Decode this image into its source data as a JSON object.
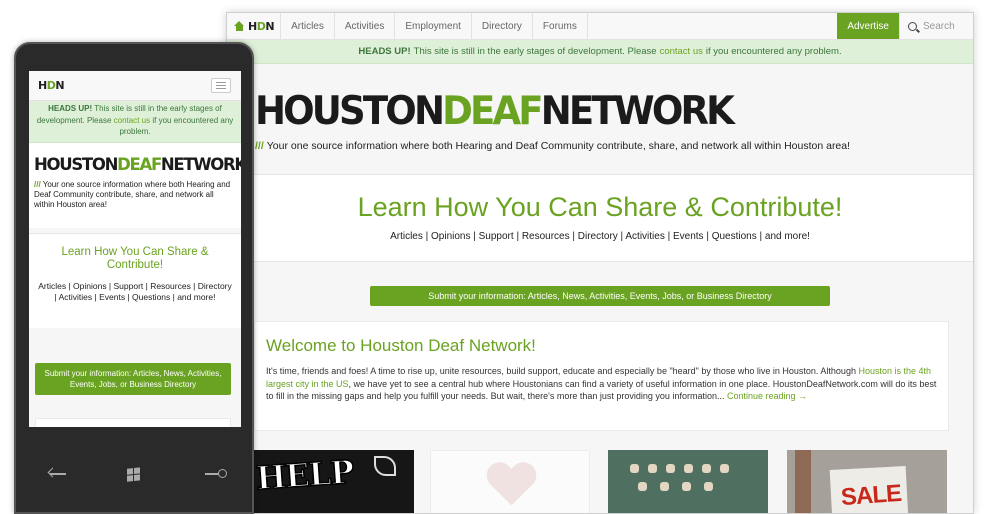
{
  "desktop": {
    "nav": {
      "logo": {
        "prefix": "H",
        "mid": "D",
        "suffix": "N"
      },
      "items": [
        "Articles",
        "Activities",
        "Employment",
        "Directory",
        "Forums"
      ],
      "advertise": "Advertise",
      "search_placeholder": "Search"
    },
    "alert": {
      "strong": "HEADS UP!",
      "text_before": "This site is still in the early stages of development. Please",
      "link": "contact us",
      "text_after": "if you encountered any problem."
    },
    "hero": {
      "logo_houston": "HOUSTON",
      "logo_deaf": "DEAF",
      "logo_network": "NETWORK",
      "tag_slashes": "///",
      "tagline": "Your one source information where both Hearing and Deaf Community contribute, share, and network all within Houston area!"
    },
    "learn": {
      "heading": "Learn How You Can Share & Contribute!",
      "links": "Articles | Opinions | Support | Resources | Directory | Activities | Events | Questions | and more!"
    },
    "submit_button": "Submit your information: Articles, News, Activities, Events, Jobs, or Business Directory",
    "welcome": {
      "title": "Welcome to Houston Deaf Network!",
      "p1": "It's time, friends and foes! A time to rise up, unite resources, build support, educate and especially be \"heard\" by those who live in Houston. Although",
      "link1": "Houston is the 4th largest city in the US",
      "p2": ", we have yet to see a central hub where Houstonians can find a variety of useful information in one place. HoustonDeafNetwork.com will do its best to fill in the missing gaps and help you fulfill your needs. But wait, there's more than just providing you information...",
      "continue": "Continue reading →"
    },
    "thumbs": {
      "t1_text": "HELP"
    },
    "t4_text": "SALE"
  },
  "phone": {
    "alert": {
      "strong": "HEADS UP!",
      "text_before": "This site is still in the early stages of development. Please",
      "link": "contact us",
      "text_after": "if you encountered any problem."
    },
    "tagline": "Your one source information where both Hearing and Deaf Community contribute, share, and network all within Houston area!",
    "learn_heading": "Learn How You Can Share & Contribute!",
    "learn_links": "Articles | Opinions | Support | Resources | Directory | Activities | Events | Questions | and more!",
    "submit_button": "Submit your information: Articles, News, Activities, Events, Jobs, or Business Directory"
  },
  "colors": {
    "accent": "#6aa221",
    "alert_bg": "#dff0d8",
    "alert_text": "#3c763d"
  },
  "icons": [
    "home-icon",
    "search-icon",
    "menu-icon",
    "back-icon",
    "windows-icon",
    "phone-search-icon"
  ]
}
